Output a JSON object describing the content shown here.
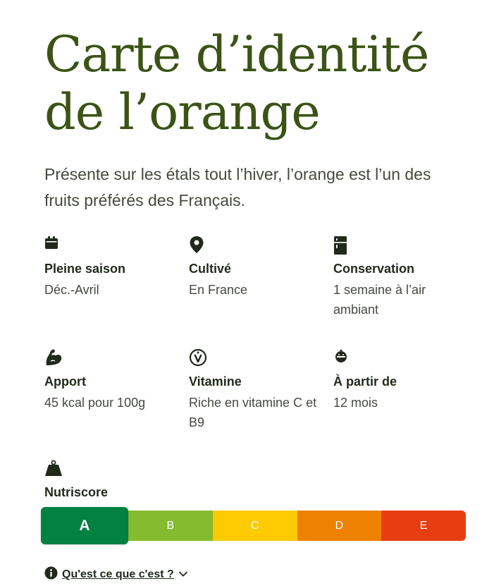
{
  "title": {
    "line1": "Carte d’identité",
    "line2": "de l’orange"
  },
  "intro": "Présente sur les étals tout l’hiver, l’orange est l’un des fruits préférés des Français.",
  "facts": [
    {
      "icon": "calendar-icon",
      "label": "Pleine saison",
      "value": "Déc.-Avril"
    },
    {
      "icon": "location-pin-icon",
      "label": "Cultivé",
      "value": "En France"
    },
    {
      "icon": "fridge-icon",
      "label": "Conservation",
      "value": "1 semaine à l’air ambiant"
    },
    {
      "icon": "muscle-arm-icon",
      "label": "Apport",
      "value": "45 kcal pour 100g"
    },
    {
      "icon": "vitamin-icon",
      "label": "Vitamine",
      "value": "Riche en vitamine C et B9"
    },
    {
      "icon": "baby-face-icon",
      "label": "À partir de",
      "value": "12 mois"
    }
  ],
  "nutriscore": {
    "icon": "weight-icon",
    "label": "Nutriscore",
    "selected": "A",
    "grades": [
      "A",
      "B",
      "C",
      "D",
      "E"
    ],
    "colors": {
      "A": "#038141",
      "B": "#85bb2f",
      "C": "#fecb02",
      "D": "#ee8100",
      "E": "#e63e11"
    }
  },
  "help": {
    "icon": "info-icon",
    "label": "Qu'est ce que c'est ?",
    "chevron": "chevron-down-icon"
  },
  "colors": {
    "title": "#3b5316",
    "text": "#444a3f",
    "heading": "#1f2a1a"
  }
}
